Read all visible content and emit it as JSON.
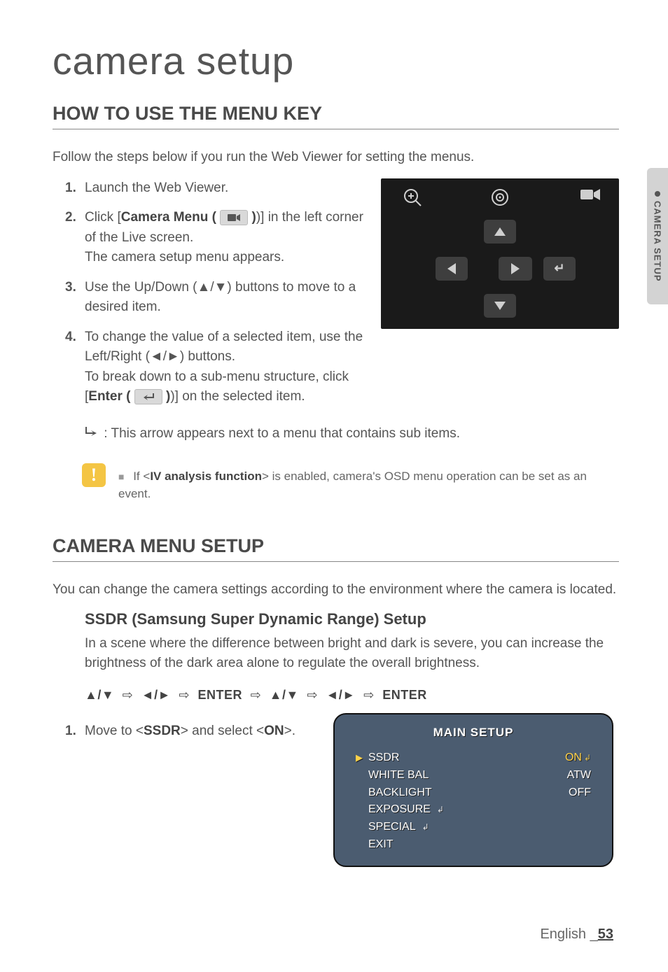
{
  "chapter": "camera setup",
  "side_tab": "CAMERA SETUP",
  "section1": {
    "heading": "HOW TO USE THE MENU KEY",
    "intro": "Follow the steps below if you run the Web Viewer for setting the menus.",
    "steps": {
      "s1": {
        "num": "1.",
        "text": "Launch the Web Viewer."
      },
      "s2": {
        "num": "2.",
        "pre": "Click [",
        "bold": "Camera Menu (",
        "post": ")] in the left corner of the Live screen.",
        "line2": "The camera setup menu appears."
      },
      "s3": {
        "num": "3.",
        "text": "Use the Up/Down (▲/▼) buttons to move to a desired item."
      },
      "s4": {
        "num": "4.",
        "l1": "To change the value of a selected item, use the Left/Right (◄/►) buttons.",
        "l2a": "To break down to a sub-menu structure, click [",
        "l2b": "Enter (",
        "l2c": ")] on the selected item."
      }
    },
    "arrow_note": ": This arrow appears next to a menu that contains sub items.",
    "info": {
      "pre": "If <",
      "bold": "IV analysis function",
      "post": "> is enabled, camera's OSD menu operation can be set as an event."
    }
  },
  "section2": {
    "heading": "CAMERA MENU SETUP",
    "intro": "You can change the camera settings according to the environment where the camera is located.",
    "sub_heading": "SSDR (Samsung Super Dynamic Range) Setup",
    "sub_text": "In a scene where the difference between bright and dark is severe, you can increase the brightness of the dark area alone to regulate the overall brightness.",
    "nav": {
      "g1": "▲/▼",
      "a": "⇨",
      "g2": "◄/►",
      "g3": "ENTER",
      "g4": "▲/▼",
      "g5": "◄/►",
      "g6": "ENTER"
    },
    "step1": {
      "num": "1.",
      "pre": "Move to <",
      "b1": "SSDR",
      "mid": "> and select <",
      "b2": "ON",
      "post": ">."
    }
  },
  "osd": {
    "title": "MAIN SETUP",
    "rows": {
      "r1": {
        "label": "SSDR",
        "val": "ON",
        "pointer": true,
        "sub": true,
        "valsub": true
      },
      "r2": {
        "label": "WHITE BAL",
        "val": "ATW"
      },
      "r3": {
        "label": "BACKLIGHT",
        "val": "OFF"
      },
      "r4": {
        "label": "EXPOSURE",
        "val": "",
        "sub": true
      },
      "r5": {
        "label": "SPECIAL",
        "val": "",
        "sub": true
      },
      "r6": {
        "label": "EXIT",
        "val": ""
      }
    }
  },
  "footer": {
    "lang": "English",
    "sep": "_",
    "page": "53"
  }
}
